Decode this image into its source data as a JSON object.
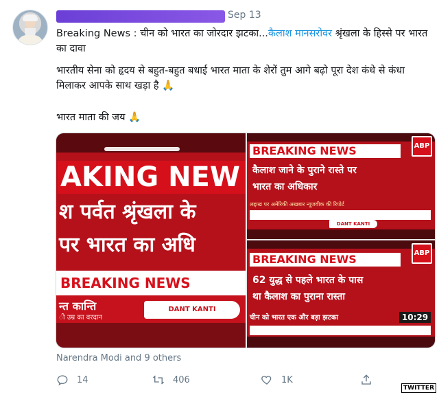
{
  "tweet": {
    "date": "Sep 13",
    "para1_a": "Breaking News : चीन को भारत का जोरदार झटका...",
    "para1_b": "कैलाश मानसरोवर",
    "para1_c": " श्रृंखला के हिस्से पर भारत का दावा",
    "para2": "भारतीय सेना को हृदय से बहुत-बहुत बधाई भारत माता के शेरों तुम आगे बढ़ो पूरा देश कंधे से कंधा मिलाकर आपके साथ खड़ा है",
    "para3": "भारत माता की जय",
    "pray_emoji": "🙏"
  },
  "media": {
    "img1": {
      "headline_big": "AKING NEW",
      "line2": "श पर्वत श्रृंखला के",
      "line3": "पर भारत का अधि",
      "breaking": "BREAKING NEWS",
      "ad_brand": "न्त कान्ति",
      "ad_sub": "ी उम्र का वरदान",
      "ad_product": "DANT KANTI"
    },
    "img2": {
      "breaking": "BREAKING NEWS",
      "logo": "ABP",
      "line1": "कैलाश जाने के पुराने रास्ते पर",
      "line2": "भारत का अधिकार",
      "ticker": "लद्दाख पर अमेरिकी अखबार न्यूजवीक की रिपोर्ट",
      "ad_product": "DANT KANTI"
    },
    "img3": {
      "breaking": "BREAKING NEWS",
      "logo": "ABP",
      "line1": "62 युद्ध से पहले भारत के पास",
      "line2": "था कैलाश का पुराना रास्ता",
      "ticker": "चीन को भारत एक और बड़ा झटका",
      "time": "10:29"
    }
  },
  "social_context": "Narendra Modi and 9 others",
  "actions": {
    "reply_count": "14",
    "retweet_count": "406",
    "like_count": "1K"
  },
  "watermark": "TWITTER",
  "colors": {
    "accent": "#1b95e0",
    "news_red": "#d6101b"
  }
}
